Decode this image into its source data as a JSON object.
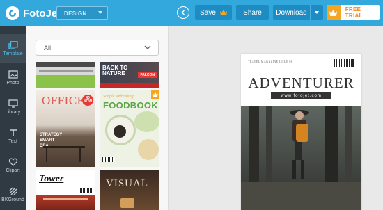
{
  "app": {
    "name": "FotoJet"
  },
  "toolbar": {
    "mode_select": "DESIGN",
    "save_label": "Save",
    "share_label": "Share",
    "download_label": "Download",
    "free_trial_label": "FREE TRIAL"
  },
  "sidebar": {
    "items": [
      {
        "label": "Template",
        "icon": "template-icon",
        "active": true
      },
      {
        "label": "Photo",
        "icon": "photo-icon"
      },
      {
        "label": "Library",
        "icon": "library-icon"
      },
      {
        "label": "Text",
        "icon": "text-icon"
      },
      {
        "label": "Clipart",
        "icon": "clipart-icon"
      },
      {
        "label": "BKGround",
        "icon": "background-icon"
      }
    ]
  },
  "panel": {
    "filter": "All",
    "templates": [
      {
        "title": ""
      },
      {
        "title": "BACK TO NATURE",
        "badge": "FALCON"
      },
      {
        "title": "OFFICE",
        "subtitle": "STRATEGY SMART DEAL",
        "badge": "40 NOW"
      },
      {
        "title": "FOODBOOK",
        "script": "Simple Refreshing"
      },
      {
        "title": "Tower"
      },
      {
        "title": "VISUAL"
      }
    ]
  },
  "canvas": {
    "cover": {
      "top_line": "TRAVEL  MAGAZINE   ISSUE 08",
      "title": "ADVENTURER",
      "url": "www.fotojet.com"
    }
  },
  "colors": {
    "brand": "#33a8dd",
    "rail": "#2f3a43",
    "accent_orange": "#f4a623"
  }
}
